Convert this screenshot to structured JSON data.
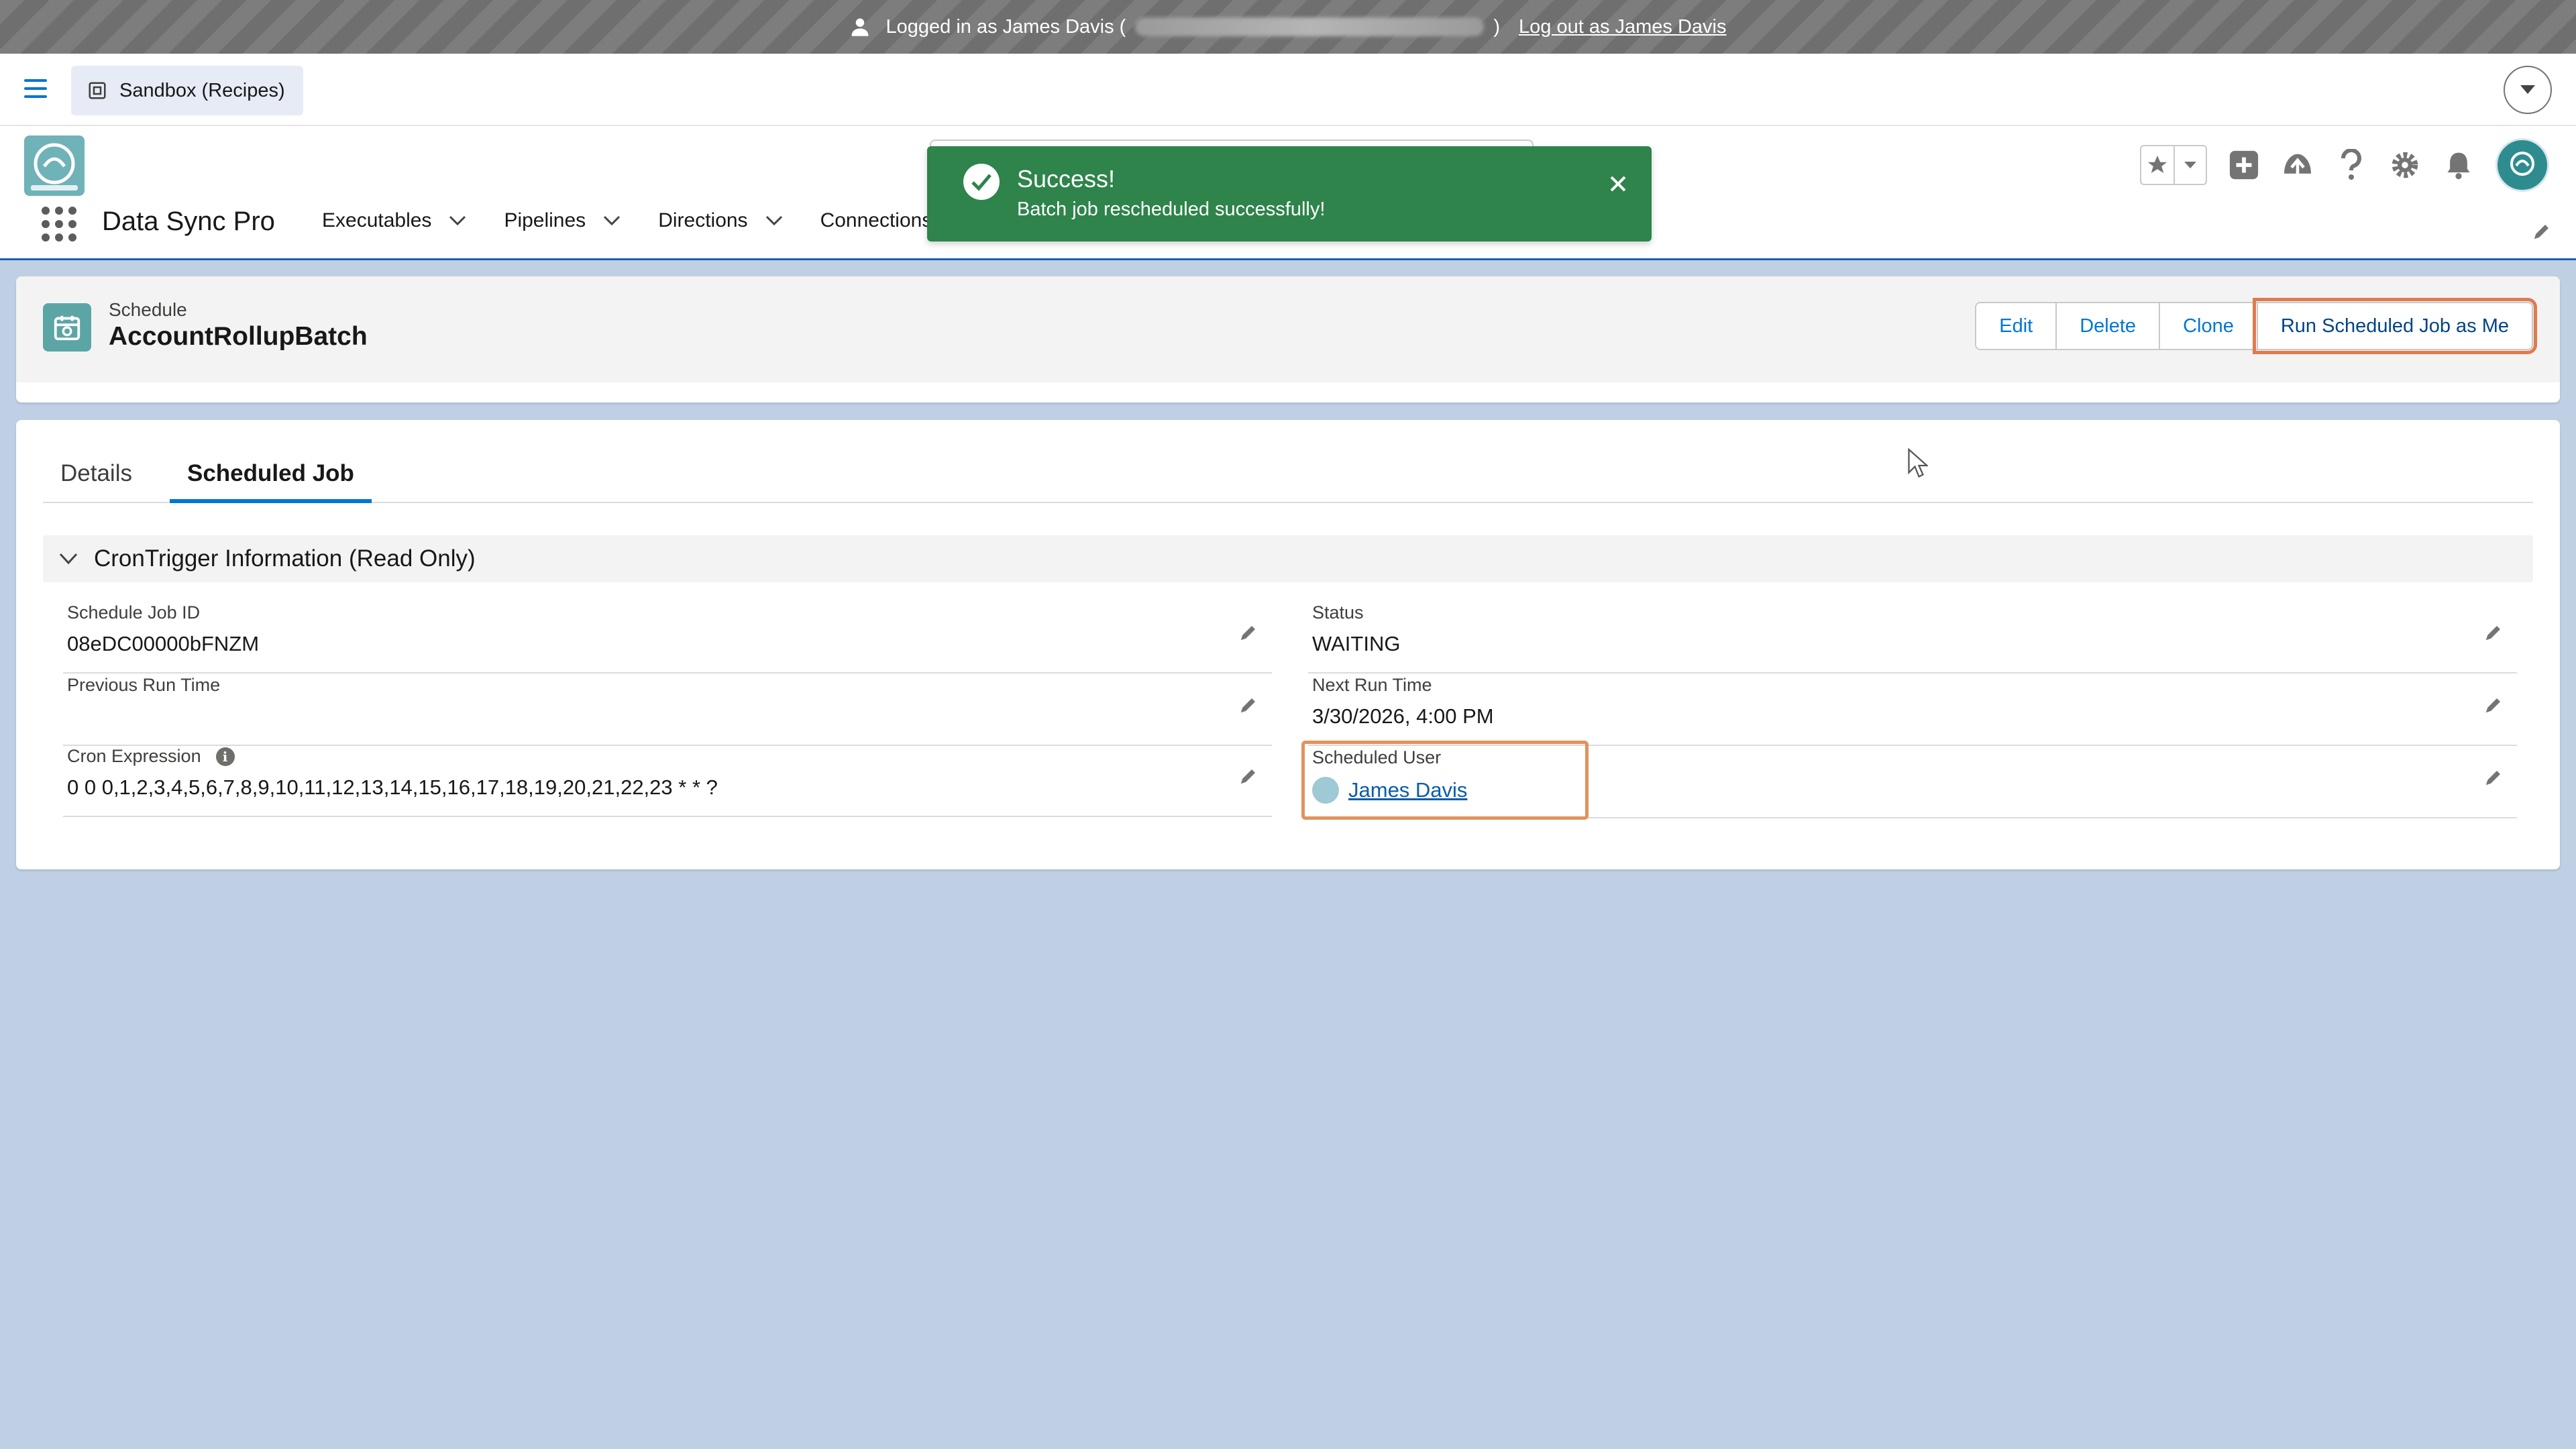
{
  "login_banner": {
    "prefix": "Logged in as James Davis (",
    "suffix": ")",
    "logout_label": "Log out as James Davis"
  },
  "setup": {
    "sandbox_label": "Sandbox (Recipes)"
  },
  "app": {
    "name": "Data Sync Pro",
    "nav": [
      {
        "label": "Executables",
        "has_menu": true
      },
      {
        "label": "Pipelines",
        "has_menu": true
      },
      {
        "label": "Directions",
        "has_menu": true
      },
      {
        "label": "Connections",
        "has_menu": false
      }
    ]
  },
  "toast": {
    "title": "Success!",
    "message": "Batch job rescheduled successfully!"
  },
  "record": {
    "type": "Schedule",
    "name": "AccountRollupBatch",
    "actions": [
      "Edit",
      "Delete",
      "Clone",
      "Run Scheduled Job as Me"
    ]
  },
  "tabs": [
    "Details",
    "Scheduled Job"
  ],
  "active_tab": "Scheduled Job",
  "section": {
    "title": "CronTrigger Information (Read Only)",
    "fields": {
      "schedule_job_id": {
        "label": "Schedule Job ID",
        "value": "08eDC00000bFNZM"
      },
      "previous_run_time": {
        "label": "Previous Run Time",
        "value": ""
      },
      "cron_expression": {
        "label": "Cron Expression",
        "value": "0 0 0,1,2,3,4,5,6,7,8,9,10,11,12,13,14,15,16,17,18,19,20,21,22,23 * * ?"
      },
      "status": {
        "label": "Status",
        "value": "WAITING"
      },
      "next_run_time": {
        "label": "Next Run Time",
        "value": "3/30/2026, 4:00 PM"
      },
      "scheduled_user": {
        "label": "Scheduled User",
        "value": "James Davis"
      }
    }
  },
  "colors": {
    "brand_blue": "#0176d3",
    "toast_green": "#2e844a",
    "highlight_orange": "#e07a4f",
    "page_background": "#bfcfe4"
  }
}
